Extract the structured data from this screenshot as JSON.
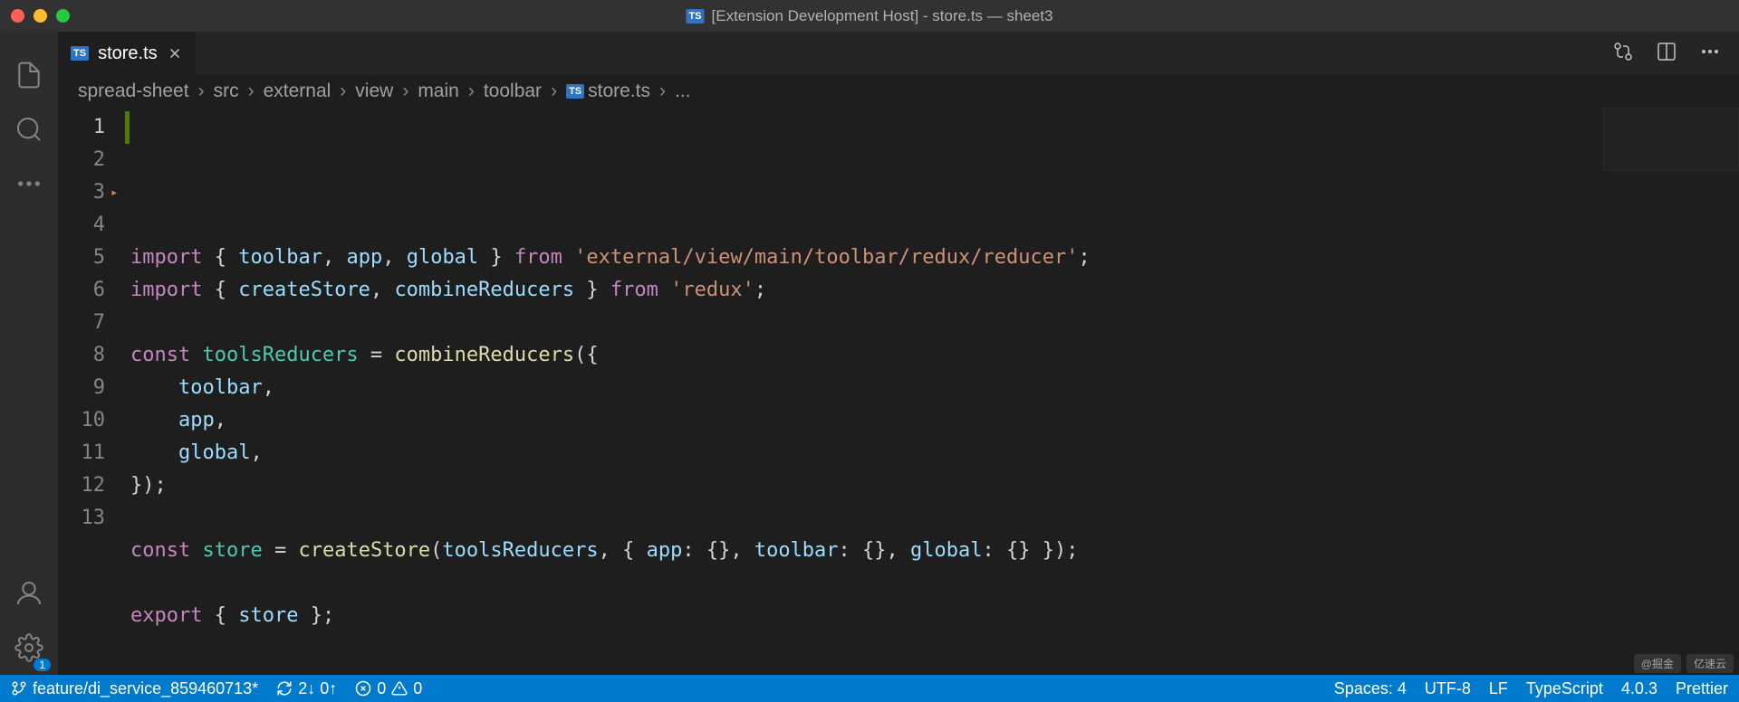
{
  "titlebar": {
    "title": "[Extension Development Host] - store.ts — sheet3",
    "file_badge": "TS"
  },
  "tabs": {
    "active": {
      "icon_badge": "TS",
      "label": "store.ts"
    }
  },
  "breadcrumb": {
    "parts": [
      "spread-sheet",
      "src",
      "external",
      "view",
      "main",
      "toolbar"
    ],
    "file_badge": "TS",
    "file": "store.ts",
    "tail": "..."
  },
  "code": {
    "line_numbers": [
      "1",
      "2",
      "3",
      "4",
      "5",
      "6",
      "7",
      "8",
      "9",
      "10",
      "11",
      "12",
      "13"
    ],
    "lines": [
      [
        {
          "t": "import",
          "c": "keyword"
        },
        {
          "t": " { ",
          "c": "punct"
        },
        {
          "t": "toolbar",
          "c": "var"
        },
        {
          "t": ", ",
          "c": "punct"
        },
        {
          "t": "app",
          "c": "var"
        },
        {
          "t": ", ",
          "c": "punct"
        },
        {
          "t": "global",
          "c": "var"
        },
        {
          "t": " } ",
          "c": "punct"
        },
        {
          "t": "from",
          "c": "keyword"
        },
        {
          "t": " ",
          "c": "punct"
        },
        {
          "t": "'external/view/main/toolbar/redux/reducer'",
          "c": "string"
        },
        {
          "t": ";",
          "c": "punct"
        }
      ],
      [
        {
          "t": "import",
          "c": "keyword"
        },
        {
          "t": " { ",
          "c": "punct"
        },
        {
          "t": "createStore",
          "c": "var"
        },
        {
          "t": ", ",
          "c": "punct"
        },
        {
          "t": "combineReducers",
          "c": "var"
        },
        {
          "t": " } ",
          "c": "punct"
        },
        {
          "t": "from",
          "c": "keyword"
        },
        {
          "t": " ",
          "c": "punct"
        },
        {
          "t": "'redux'",
          "c": "string"
        },
        {
          "t": ";",
          "c": "punct"
        }
      ],
      [],
      [
        {
          "t": "const",
          "c": "keyword"
        },
        {
          "t": " ",
          "c": "punct"
        },
        {
          "t": "toolsReducers",
          "c": "type"
        },
        {
          "t": " = ",
          "c": "punct"
        },
        {
          "t": "combineReducers",
          "c": "func"
        },
        {
          "t": "({",
          "c": "punct"
        }
      ],
      [
        {
          "t": "    ",
          "c": "punct"
        },
        {
          "t": "toolbar",
          "c": "var"
        },
        {
          "t": ",",
          "c": "punct"
        }
      ],
      [
        {
          "t": "    ",
          "c": "punct"
        },
        {
          "t": "app",
          "c": "var"
        },
        {
          "t": ",",
          "c": "punct"
        }
      ],
      [
        {
          "t": "    ",
          "c": "punct"
        },
        {
          "t": "global",
          "c": "var"
        },
        {
          "t": ",",
          "c": "punct"
        }
      ],
      [
        {
          "t": "});",
          "c": "punct"
        }
      ],
      [],
      [
        {
          "t": "const",
          "c": "keyword"
        },
        {
          "t": " ",
          "c": "punct"
        },
        {
          "t": "store",
          "c": "type"
        },
        {
          "t": " = ",
          "c": "punct"
        },
        {
          "t": "createStore",
          "c": "func"
        },
        {
          "t": "(",
          "c": "punct"
        },
        {
          "t": "toolsReducers",
          "c": "var"
        },
        {
          "t": ", { ",
          "c": "punct"
        },
        {
          "t": "app",
          "c": "var"
        },
        {
          "t": ": {}, ",
          "c": "punct"
        },
        {
          "t": "toolbar",
          "c": "var"
        },
        {
          "t": ": {}, ",
          "c": "punct"
        },
        {
          "t": "global",
          "c": "var"
        },
        {
          "t": ": {} });",
          "c": "punct"
        }
      ],
      [],
      [
        {
          "t": "export",
          "c": "keyword"
        },
        {
          "t": " { ",
          "c": "punct"
        },
        {
          "t": "store",
          "c": "var"
        },
        {
          "t": " };",
          "c": "punct"
        }
      ],
      []
    ]
  },
  "activity": {
    "badge": "1"
  },
  "status": {
    "branch": "feature/di_service_859460713*",
    "sync": "2↓ 0↑",
    "errors": "0",
    "warnings": "0",
    "spaces": "Spaces: 4",
    "encoding": "UTF-8",
    "eol": "LF",
    "language": "TypeScript",
    "ts_version": "4.0.3",
    "formatter": "Prettier"
  },
  "watermark": {
    "a": "@掘金",
    "b": "亿速云"
  }
}
